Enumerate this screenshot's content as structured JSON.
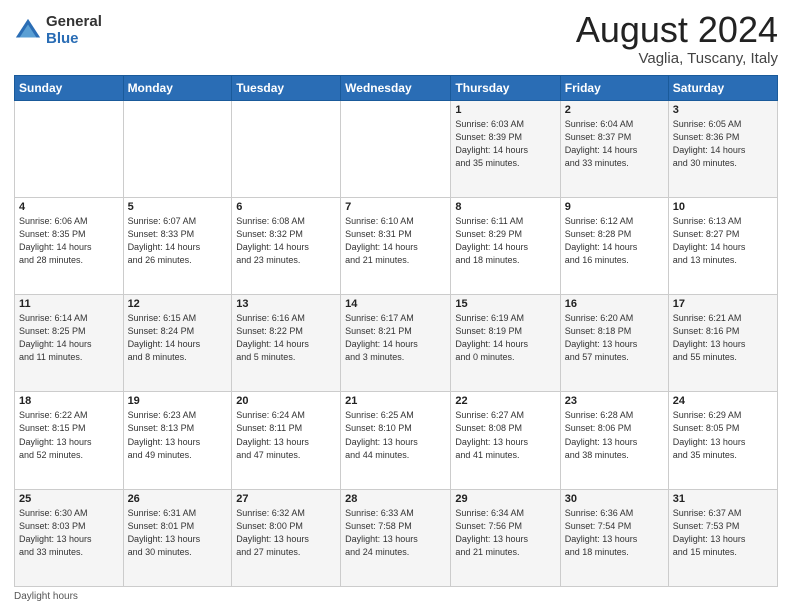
{
  "logo": {
    "general": "General",
    "blue": "Blue"
  },
  "header": {
    "title": "August 2024",
    "subtitle": "Vaglia, Tuscany, Italy"
  },
  "weekdays": [
    "Sunday",
    "Monday",
    "Tuesday",
    "Wednesday",
    "Thursday",
    "Friday",
    "Saturday"
  ],
  "weeks": [
    [
      {
        "day": "",
        "info": ""
      },
      {
        "day": "",
        "info": ""
      },
      {
        "day": "",
        "info": ""
      },
      {
        "day": "",
        "info": ""
      },
      {
        "day": "1",
        "info": "Sunrise: 6:03 AM\nSunset: 8:39 PM\nDaylight: 14 hours\nand 35 minutes."
      },
      {
        "day": "2",
        "info": "Sunrise: 6:04 AM\nSunset: 8:37 PM\nDaylight: 14 hours\nand 33 minutes."
      },
      {
        "day": "3",
        "info": "Sunrise: 6:05 AM\nSunset: 8:36 PM\nDaylight: 14 hours\nand 30 minutes."
      }
    ],
    [
      {
        "day": "4",
        "info": "Sunrise: 6:06 AM\nSunset: 8:35 PM\nDaylight: 14 hours\nand 28 minutes."
      },
      {
        "day": "5",
        "info": "Sunrise: 6:07 AM\nSunset: 8:33 PM\nDaylight: 14 hours\nand 26 minutes."
      },
      {
        "day": "6",
        "info": "Sunrise: 6:08 AM\nSunset: 8:32 PM\nDaylight: 14 hours\nand 23 minutes."
      },
      {
        "day": "7",
        "info": "Sunrise: 6:10 AM\nSunset: 8:31 PM\nDaylight: 14 hours\nand 21 minutes."
      },
      {
        "day": "8",
        "info": "Sunrise: 6:11 AM\nSunset: 8:29 PM\nDaylight: 14 hours\nand 18 minutes."
      },
      {
        "day": "9",
        "info": "Sunrise: 6:12 AM\nSunset: 8:28 PM\nDaylight: 14 hours\nand 16 minutes."
      },
      {
        "day": "10",
        "info": "Sunrise: 6:13 AM\nSunset: 8:27 PM\nDaylight: 14 hours\nand 13 minutes."
      }
    ],
    [
      {
        "day": "11",
        "info": "Sunrise: 6:14 AM\nSunset: 8:25 PM\nDaylight: 14 hours\nand 11 minutes."
      },
      {
        "day": "12",
        "info": "Sunrise: 6:15 AM\nSunset: 8:24 PM\nDaylight: 14 hours\nand 8 minutes."
      },
      {
        "day": "13",
        "info": "Sunrise: 6:16 AM\nSunset: 8:22 PM\nDaylight: 14 hours\nand 5 minutes."
      },
      {
        "day": "14",
        "info": "Sunrise: 6:17 AM\nSunset: 8:21 PM\nDaylight: 14 hours\nand 3 minutes."
      },
      {
        "day": "15",
        "info": "Sunrise: 6:19 AM\nSunset: 8:19 PM\nDaylight: 14 hours\nand 0 minutes."
      },
      {
        "day": "16",
        "info": "Sunrise: 6:20 AM\nSunset: 8:18 PM\nDaylight: 13 hours\nand 57 minutes."
      },
      {
        "day": "17",
        "info": "Sunrise: 6:21 AM\nSunset: 8:16 PM\nDaylight: 13 hours\nand 55 minutes."
      }
    ],
    [
      {
        "day": "18",
        "info": "Sunrise: 6:22 AM\nSunset: 8:15 PM\nDaylight: 13 hours\nand 52 minutes."
      },
      {
        "day": "19",
        "info": "Sunrise: 6:23 AM\nSunset: 8:13 PM\nDaylight: 13 hours\nand 49 minutes."
      },
      {
        "day": "20",
        "info": "Sunrise: 6:24 AM\nSunset: 8:11 PM\nDaylight: 13 hours\nand 47 minutes."
      },
      {
        "day": "21",
        "info": "Sunrise: 6:25 AM\nSunset: 8:10 PM\nDaylight: 13 hours\nand 44 minutes."
      },
      {
        "day": "22",
        "info": "Sunrise: 6:27 AM\nSunset: 8:08 PM\nDaylight: 13 hours\nand 41 minutes."
      },
      {
        "day": "23",
        "info": "Sunrise: 6:28 AM\nSunset: 8:06 PM\nDaylight: 13 hours\nand 38 minutes."
      },
      {
        "day": "24",
        "info": "Sunrise: 6:29 AM\nSunset: 8:05 PM\nDaylight: 13 hours\nand 35 minutes."
      }
    ],
    [
      {
        "day": "25",
        "info": "Sunrise: 6:30 AM\nSunset: 8:03 PM\nDaylight: 13 hours\nand 33 minutes."
      },
      {
        "day": "26",
        "info": "Sunrise: 6:31 AM\nSunset: 8:01 PM\nDaylight: 13 hours\nand 30 minutes."
      },
      {
        "day": "27",
        "info": "Sunrise: 6:32 AM\nSunset: 8:00 PM\nDaylight: 13 hours\nand 27 minutes."
      },
      {
        "day": "28",
        "info": "Sunrise: 6:33 AM\nSunset: 7:58 PM\nDaylight: 13 hours\nand 24 minutes."
      },
      {
        "day": "29",
        "info": "Sunrise: 6:34 AM\nSunset: 7:56 PM\nDaylight: 13 hours\nand 21 minutes."
      },
      {
        "day": "30",
        "info": "Sunrise: 6:36 AM\nSunset: 7:54 PM\nDaylight: 13 hours\nand 18 minutes."
      },
      {
        "day": "31",
        "info": "Sunrise: 6:37 AM\nSunset: 7:53 PM\nDaylight: 13 hours\nand 15 minutes."
      }
    ]
  ],
  "footer": {
    "daylight_label": "Daylight hours"
  },
  "colors": {
    "header_bg": "#2a6db5",
    "header_text": "#ffffff",
    "odd_row": "#f5f5f5",
    "even_row": "#ffffff"
  }
}
